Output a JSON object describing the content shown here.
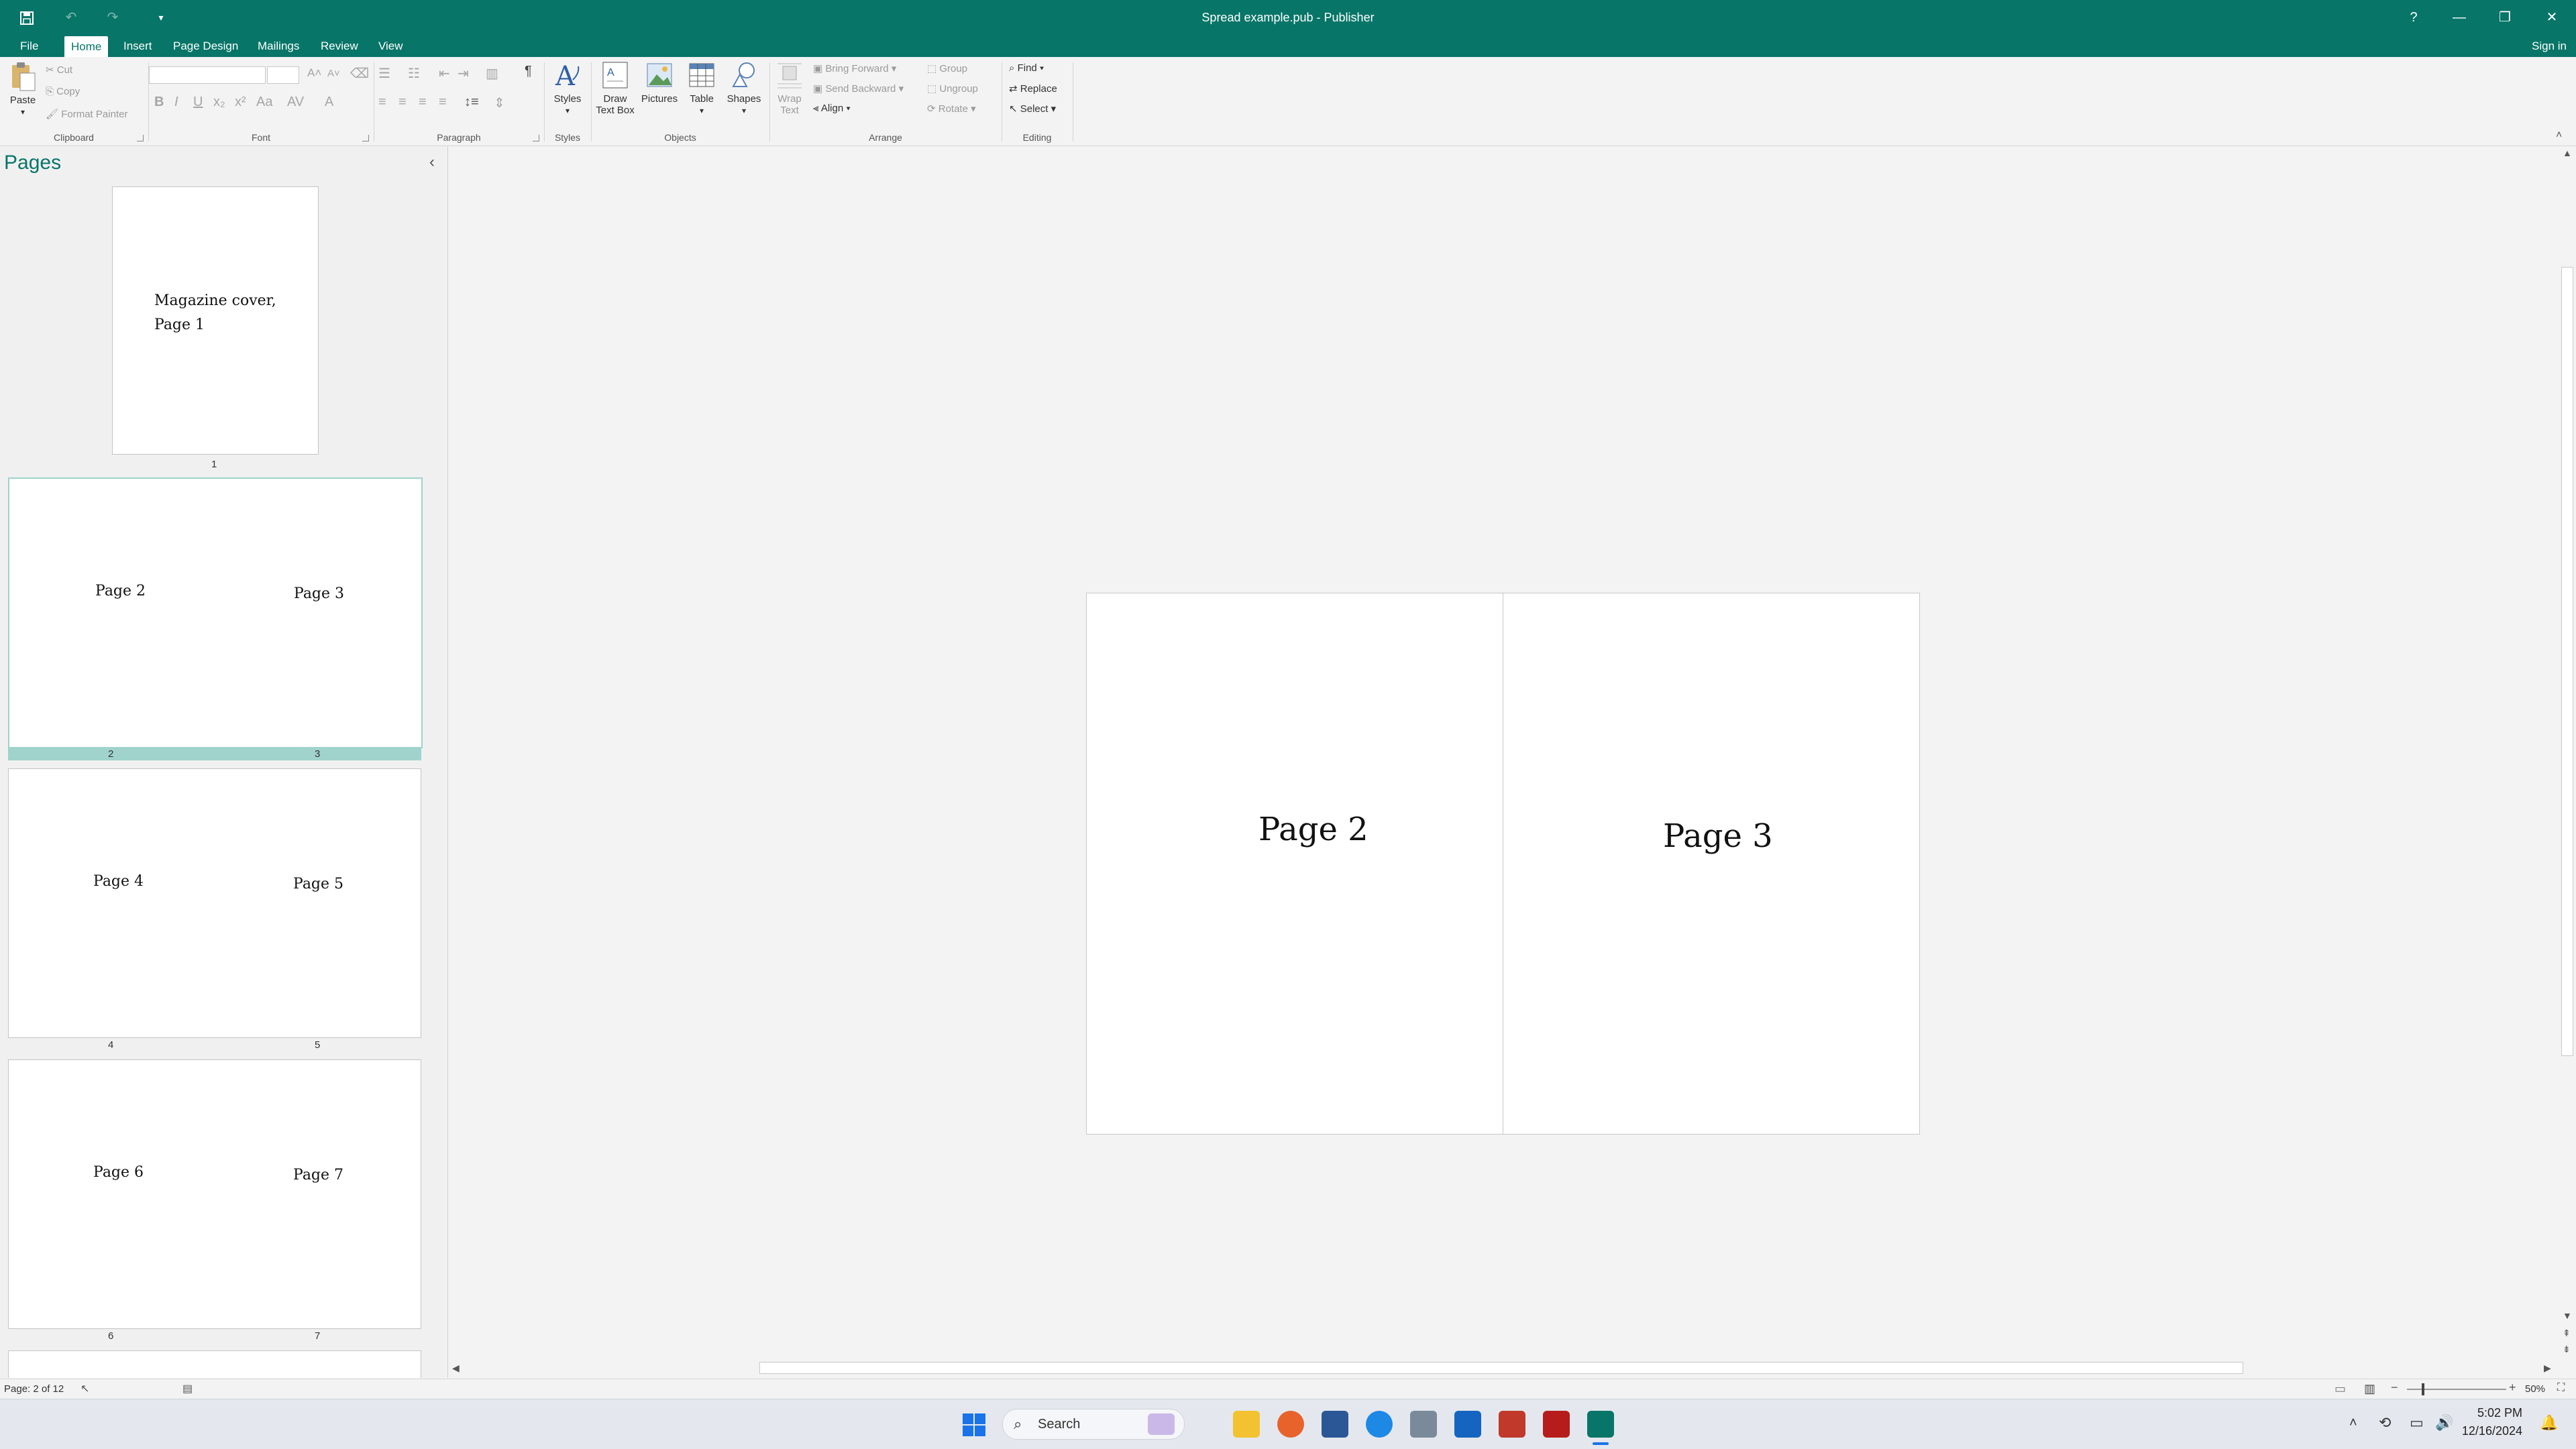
{
  "window": {
    "title": "Spread example.pub - Publisher"
  },
  "tabs": [
    {
      "label": "File"
    },
    {
      "label": "Home"
    },
    {
      "label": "Insert"
    },
    {
      "label": "Page Design"
    },
    {
      "label": "Mailings"
    },
    {
      "label": "Review"
    },
    {
      "label": "View"
    }
  ],
  "signin": "Sign in",
  "ribbon": {
    "clipboard": {
      "label": "Clipboard",
      "paste": "Paste",
      "cut": "Cut",
      "copy": "Copy",
      "format_painter": "Format Painter"
    },
    "font": {
      "label": "Font"
    },
    "paragraph": {
      "label": "Paragraph"
    },
    "styles": {
      "label": "Styles",
      "styles_btn": "Styles"
    },
    "objects": {
      "label": "Objects",
      "draw_text_box_1": "Draw",
      "draw_text_box_2": "Text Box",
      "pictures": "Pictures",
      "table": "Table",
      "shapes": "Shapes"
    },
    "arrange": {
      "label": "Arrange",
      "wrap_text_1": "Wrap",
      "wrap_text_2": "Text",
      "bring_forward": "Bring Forward",
      "send_backward": "Send Backward",
      "align": "Align",
      "group": "Group",
      "ungroup": "Ungroup",
      "rotate": "Rotate"
    },
    "editing": {
      "label": "Editing",
      "find": "Find",
      "replace": "Replace",
      "select": "Select"
    }
  },
  "pages_pane": {
    "title": "Pages",
    "thumbnails": [
      {
        "lines": [
          "Magazine cover,",
          "Page 1"
        ],
        "nums": [
          "1"
        ]
      },
      {
        "left": "Page 2",
        "right": "Page 3",
        "nums": [
          "2",
          "3"
        ]
      },
      {
        "left": "Page 4",
        "right": "Page 5",
        "nums": [
          "4",
          "5"
        ]
      },
      {
        "left": "Page 6",
        "right": "Page 7",
        "nums": [
          "6",
          "7"
        ]
      }
    ]
  },
  "spread": {
    "left_text": "Page 2",
    "right_text": "Page 3"
  },
  "status": {
    "page_info": "Page: 2 of 12",
    "zoom": "50%"
  },
  "taskbar": {
    "search_placeholder": "Search",
    "time": "5:02 PM",
    "date": "12/16/2024"
  },
  "colors": {
    "accent": "#077568",
    "selection": "#9fd3cc"
  }
}
